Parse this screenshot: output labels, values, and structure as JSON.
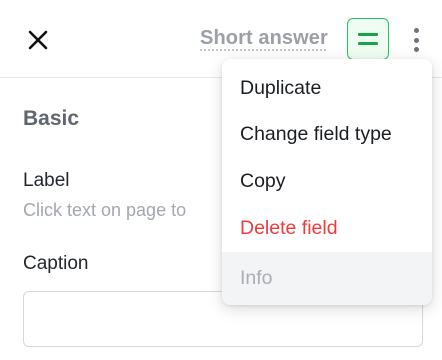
{
  "header": {
    "close_icon": "close-icon",
    "field_type_label": "Short answer",
    "type_icon": "short-answer-icon",
    "more_icon": "more-vertical-icon",
    "accent_color": "#22c55e"
  },
  "panel": {
    "section_title": "Basic",
    "label_title": "Label",
    "label_hint": "Click text on page to",
    "caption_title": "Caption",
    "caption_value": ""
  },
  "menu": {
    "items": [
      {
        "label": "Duplicate"
      },
      {
        "label": "Change field type"
      },
      {
        "label": "Copy"
      },
      {
        "label": "Delete field",
        "style": "danger",
        "color": "#ef3b3b"
      },
      {
        "label": "Info",
        "style": "disabled"
      }
    ]
  }
}
